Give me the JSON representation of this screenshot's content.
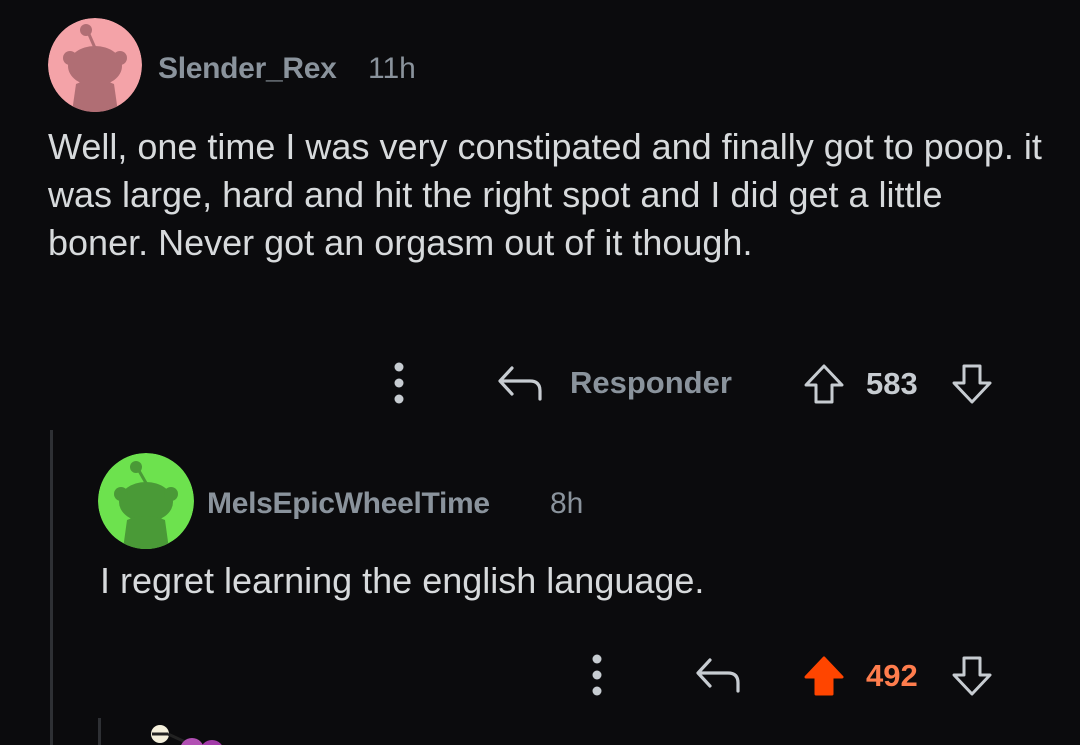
{
  "comments": [
    {
      "username": "Slender_Rex",
      "time": "11h",
      "body": "Well, one time I was very constipated and finally got to poop. it was large, hard and hit the right spot and I did get a little boner. Never got an orgasm out of it though.",
      "reply_label": "Responder",
      "score": "583",
      "avatar_color": "#f4a3a8",
      "vote_state": "none"
    },
    {
      "username": "MelsEpicWheelTime",
      "time": "8h",
      "body": "I regret learning the english language.",
      "score": "492",
      "avatar_color": "#6de24e",
      "vote_state": "upvoted",
      "upvote_color": "#ff4500",
      "score_color": "#ff7d4d"
    }
  ]
}
